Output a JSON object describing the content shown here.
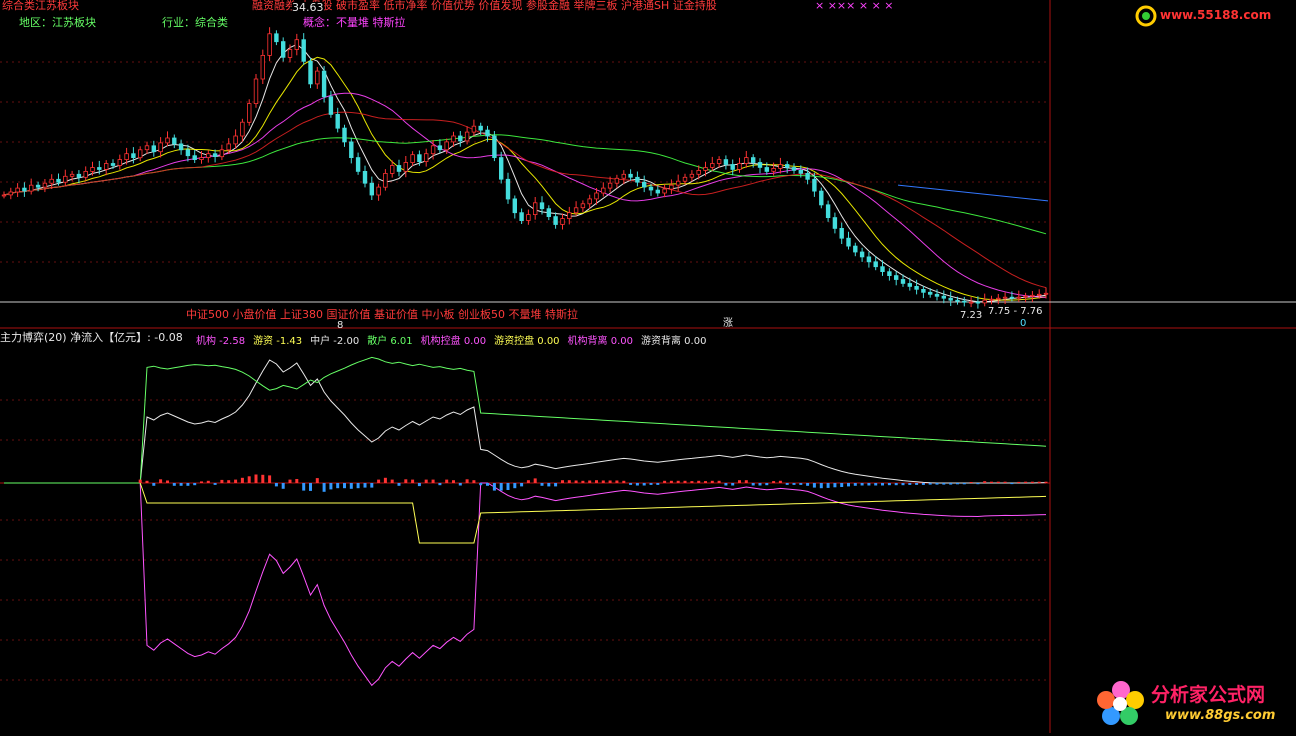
{
  "header": {
    "title": "综合类江苏板块",
    "tags_line": "融资融券 小盘股 破市盈率 低市净率 价值优势 价值发现 参股金融 举牌三板 沪港通SH 证金持股",
    "crosses": "×  ×××  ×  ×  ×",
    "price_label": "34.63",
    "region": "地区：江苏板块",
    "industry": "行业：综合类",
    "concept": "概念：不量堆 特斯拉"
  },
  "mid_labels": {
    "index_tags": "中证500 小盘价值 上证380 国证价值 基证价值 中小板 创业板50 不量堆 特斯拉",
    "low_price": "7.23",
    "range_price": "7.75 - 7.76",
    "right_marker": "0",
    "mid_marker": "8",
    "mid_marker2": "涨"
  },
  "indicator": {
    "label_main": "主力博弈(20) 净流入【亿元】: -0.08",
    "items": [
      {
        "text": "机构 -2.58",
        "color": "#ff55ff"
      },
      {
        "text": "游资 -1.43",
        "color": "#ffff55"
      },
      {
        "text": "中户 -2.00",
        "color": "#e8e8e8"
      },
      {
        "text": "散户 6.01",
        "color": "#66ff66"
      },
      {
        "text": "机构控盘 0.00",
        "color": "#ff55ff"
      },
      {
        "text": "游资控盘 0.00",
        "color": "#ffff55"
      },
      {
        "text": "机构背离 0.00",
        "color": "#ff55ff"
      },
      {
        "text": "游资背离 0.00",
        "color": "#e8e8e8"
      }
    ]
  },
  "logos": {
    "top": "www.55188.com",
    "bottom_cn": "分析家公式网",
    "bottom_url": "www.88gs.com"
  },
  "chart_data": [
    {
      "type": "candlestick",
      "title": "",
      "panel": "price",
      "x_count": 200,
      "closes": [
        18.2,
        18.5,
        18.9,
        18.6,
        19.2,
        19.0,
        19.4,
        19.8,
        19.5,
        20.1,
        20.3,
        20.0,
        20.6,
        21.0,
        20.8,
        21.4,
        21.2,
        21.8,
        22.4,
        22.0,
        22.8,
        23.2,
        22.6,
        23.5,
        24.0,
        23.4,
        22.8,
        22.2,
        21.8,
        22.0,
        22.4,
        22.1,
        22.8,
        23.4,
        24.2,
        25.6,
        27.5,
        30.0,
        32.4,
        34.6,
        33.8,
        32.2,
        33.0,
        34.0,
        31.8,
        29.5,
        30.8,
        28.2,
        26.4,
        25.0,
        23.6,
        22.0,
        20.6,
        19.4,
        18.2,
        19.0,
        20.4,
        21.2,
        20.6,
        21.5,
        22.3,
        21.6,
        22.4,
        23.2,
        22.8,
        23.6,
        24.2,
        23.7,
        24.6,
        25.2,
        24.8,
        24.2,
        22.0,
        19.8,
        17.8,
        16.4,
        15.6,
        16.2,
        17.4,
        16.8,
        16.0,
        15.2,
        15.8,
        16.4,
        16.9,
        17.3,
        17.8,
        18.4,
        18.9,
        19.4,
        19.9,
        20.3,
        20.0,
        19.5,
        19.0,
        18.7,
        18.4,
        18.8,
        19.2,
        19.6,
        20.0,
        20.3,
        20.7,
        21.0,
        21.4,
        21.8,
        21.3,
        20.8,
        21.4,
        22.0,
        21.5,
        21.0,
        20.6,
        20.9,
        21.3,
        21.0,
        20.7,
        20.4,
        19.8,
        18.6,
        17.2,
        15.9,
        14.8,
        13.8,
        13.0,
        12.4,
        11.9,
        11.4,
        10.9,
        10.4,
        10.0,
        9.6,
        9.2,
        8.9,
        8.6,
        8.3,
        8.1,
        7.9,
        7.7,
        7.5,
        7.4,
        7.3,
        7.3,
        7.23,
        7.5,
        7.6,
        7.7,
        7.8,
        7.75,
        7.8,
        7.9,
        8.0,
        8.1,
        8.2
      ],
      "ma_series": [
        {
          "color": "#ffffff"
        },
        {
          "color": "#ffff00"
        },
        {
          "color": "#ff44ff"
        },
        {
          "color": "#44ff44"
        },
        {
          "color": "#dd2222"
        }
      ],
      "ylim": [
        6.5,
        36
      ]
    },
    {
      "type": "line",
      "panel": "indicator",
      "title": "主力博弈(20)",
      "series": [
        {
          "name": "机构",
          "color": "#ff55ff"
        },
        {
          "name": "游资",
          "color": "#ffff55"
        },
        {
          "name": "中户",
          "color": "#e8e8e8"
        },
        {
          "name": "散户",
          "color": "#66ff66"
        }
      ]
    }
  ]
}
